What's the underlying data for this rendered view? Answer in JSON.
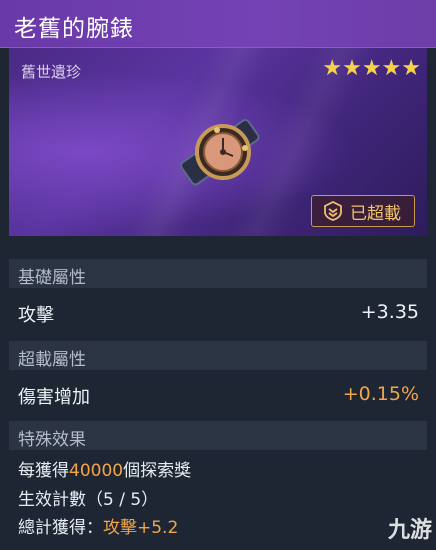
{
  "item": {
    "name": "老舊的腕錶",
    "rarity": "舊世遺珍",
    "stars": "★★★★★",
    "status": "已超載"
  },
  "sections": {
    "base": "基礎屬性",
    "overload": "超載屬性",
    "special": "特殊效果"
  },
  "stats": {
    "base": {
      "label": "攻擊",
      "value": "+3.35"
    },
    "overload": {
      "label": "傷害增加",
      "value": "+0.15%"
    }
  },
  "special": {
    "line1_prefix": "每獲得",
    "line1_amount": "40000",
    "line1_suffix": "個探索獎",
    "line2": "生效計數（5 / 5）",
    "line3_prefix": "總計獲得：",
    "line3_value": "攻擊+5.2"
  },
  "watermark": "九游",
  "colors": {
    "header": "#7442b4",
    "accent": "#f3a54a",
    "star": "#f6d24a"
  }
}
